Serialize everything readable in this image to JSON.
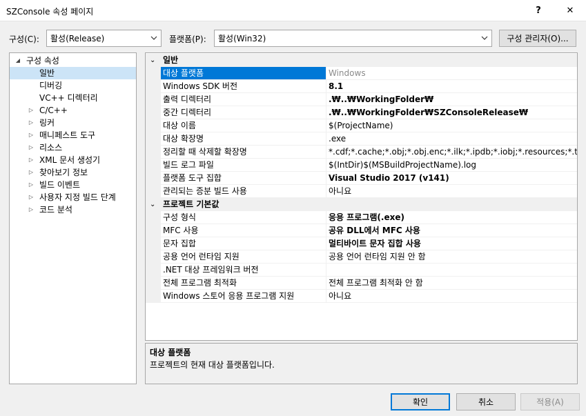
{
  "window": {
    "title": "SZConsole 속성 페이지",
    "help_glyph": "?",
    "close_glyph": "✕"
  },
  "toolbar": {
    "config_label": "구성(C):",
    "config_value": "활성(Release)",
    "platform_label": "플랫폼(P):",
    "platform_value": "활성(Win32)",
    "config_manager_label": "구성 관리자(O)..."
  },
  "tree": {
    "items": [
      {
        "label": "구성 속성",
        "expander": "◢"
      },
      {
        "label": "일반",
        "selected": true
      },
      {
        "label": "디버깅"
      },
      {
        "label": "VC++ 디렉터리"
      },
      {
        "label": "C/C++",
        "expander": "▷"
      },
      {
        "label": "링커",
        "expander": "▷"
      },
      {
        "label": "매니페스트 도구",
        "expander": "▷"
      },
      {
        "label": "리소스",
        "expander": "▷"
      },
      {
        "label": "XML 문서 생성기",
        "expander": "▷"
      },
      {
        "label": "찾아보기 정보",
        "expander": "▷"
      },
      {
        "label": "빌드 이벤트",
        "expander": "▷"
      },
      {
        "label": "사용자 지정 빌드 단계",
        "expander": "▷"
      },
      {
        "label": "코드 분석",
        "expander": "▷"
      }
    ]
  },
  "grid": {
    "categories": [
      {
        "label": "일반",
        "chevron": "⌄",
        "rows": [
          {
            "name": "대상 플랫폼",
            "value": "Windows",
            "style": "gray",
            "selected": true
          },
          {
            "name": "Windows SDK 버전",
            "value": "8.1",
            "style": "bold"
          },
          {
            "name": "출력 디렉터리",
            "value": ".₩..₩WorkingFolder₩",
            "style": "bold"
          },
          {
            "name": "중간 디렉터리",
            "value": ".₩..₩WorkingFolder₩SZConsoleRelease₩",
            "style": "bold"
          },
          {
            "name": "대상 이름",
            "value": "$(ProjectName)",
            "style": ""
          },
          {
            "name": "대상 확장명",
            "value": ".exe",
            "style": ""
          },
          {
            "name": "정리할 때 삭제할 확장명",
            "value": "*.cdf;*.cache;*.obj;*.obj.enc;*.ilk;*.ipdb;*.iobj;*.resources;*.tlb;*.tli;*.tl",
            "style": ""
          },
          {
            "name": "빌드 로그 파일",
            "value": "$(IntDir)$(MSBuildProjectName).log",
            "style": ""
          },
          {
            "name": "플랫폼 도구 집합",
            "value": "Visual Studio 2017 (v141)",
            "style": "bold"
          },
          {
            "name": "관리되는 증분 빌드 사용",
            "value": "아니요",
            "style": ""
          }
        ]
      },
      {
        "label": "프로젝트 기본값",
        "chevron": "⌄",
        "rows": [
          {
            "name": "구성 형식",
            "value": "응용 프로그램(.exe)",
            "style": "bold"
          },
          {
            "name": "MFC 사용",
            "value": "공유 DLL에서 MFC 사용",
            "style": "bold"
          },
          {
            "name": "문자 집합",
            "value": "멀티바이트 문자 집합 사용",
            "style": "bold"
          },
          {
            "name": "공용 언어 런타임 지원",
            "value": "공용 언어 런타임 지원 안 함",
            "style": ""
          },
          {
            "name": ".NET 대상 프레임워크 버전",
            "value": "",
            "style": ""
          },
          {
            "name": "전체 프로그램 최적화",
            "value": "전체 프로그램 최적화 안 함",
            "style": ""
          },
          {
            "name": "Windows 스토어 응용 프로그램 지원",
            "value": "아니요",
            "style": ""
          }
        ]
      }
    ]
  },
  "description": {
    "title": "대상 플랫폼",
    "text": "프로젝트의 현재 대상 플랫폼입니다."
  },
  "buttons": {
    "ok": "확인",
    "cancel": "취소",
    "apply": "적용(A)"
  },
  "colors": {
    "selection": "#0078d7",
    "tree_selection": "#cce4f7",
    "dialog_bg": "#f0f0f0"
  }
}
